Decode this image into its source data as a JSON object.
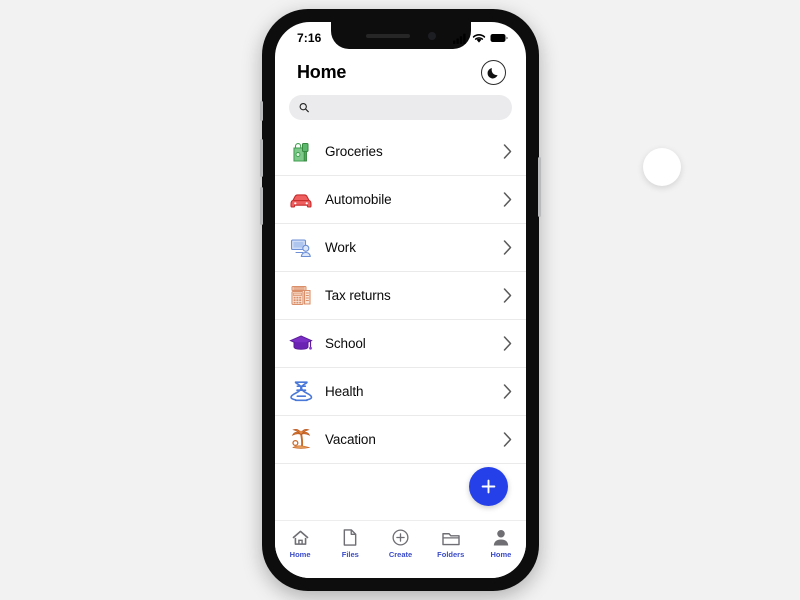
{
  "canvas": {
    "background_color": "#f2f2f2",
    "cursor": {
      "name": "cursor-circle",
      "color": "#ffffff"
    }
  },
  "phone": {
    "frame_color": "#0d0d0d",
    "screen_color": "#ffffff"
  },
  "status_bar": {
    "time": "7:16",
    "icons": [
      "cellular-signal-icon",
      "wifi-icon",
      "battery-icon"
    ]
  },
  "header": {
    "title": "Home",
    "dark_mode_toggle": {
      "icon": "moon-icon",
      "label": "Dark mode"
    }
  },
  "search": {
    "icon": "search-icon",
    "value": "",
    "placeholder": ""
  },
  "list": {
    "items": [
      {
        "label": "Groceries",
        "icon": "grocery-bag-icon",
        "color": "#4caf50"
      },
      {
        "label": "Automobile",
        "icon": "car-icon",
        "color": "#e03b3b"
      },
      {
        "label": "Work",
        "icon": "work-desk-icon",
        "color": "#7b9bdd"
      },
      {
        "label": "Tax returns",
        "icon": "calculator-icon",
        "color": "#e9a385"
      },
      {
        "label": "School",
        "icon": "graduation-cap-icon",
        "color": "#6a2ab0"
      },
      {
        "label": "Health",
        "icon": "health-dna-icon",
        "color": "#3f6fd8"
      },
      {
        "label": "Vacation",
        "icon": "palm-tree-icon",
        "color": "#d4682a"
      }
    ],
    "chevron_icon": "chevron-right-icon"
  },
  "fab": {
    "icon": "plus-icon",
    "label": "Add",
    "color": "#2540e8"
  },
  "tab_bar": {
    "active_color": "#3b4cc8",
    "items": [
      {
        "label": "Home",
        "icon": "home-icon"
      },
      {
        "label": "Files",
        "icon": "file-icon"
      },
      {
        "label": "Create",
        "icon": "plus-circle-icon"
      },
      {
        "label": "Folders",
        "icon": "folder-icon"
      },
      {
        "label": "Home",
        "icon": "person-icon"
      }
    ]
  }
}
